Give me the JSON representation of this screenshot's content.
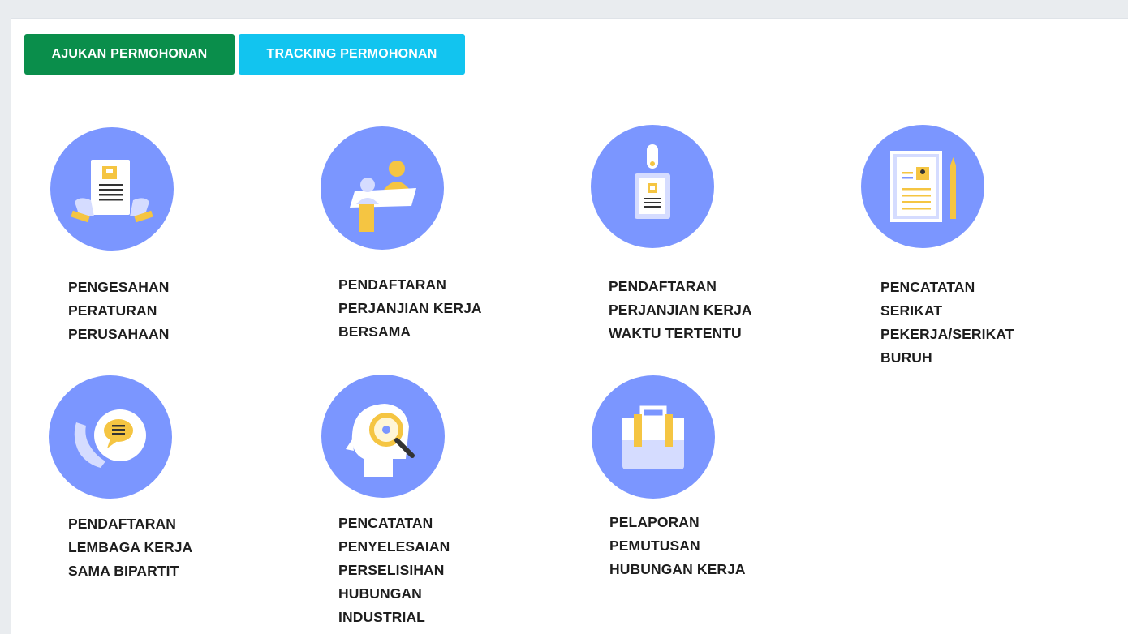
{
  "buttons": {
    "ajukan": "AJUKAN PERMOHONAN",
    "tracking": "TRACKING PERMOHONAN"
  },
  "colors": {
    "ajukan": "#0a8e4b",
    "tracking": "#12c4ef",
    "icon_circle": "#7b96ff",
    "icon_accent": "#f5c542"
  },
  "services": [
    {
      "icon": "document-hands-icon",
      "lines": [
        "PENGESAHAN",
        "PERATURAN",
        "PERUSAHAAN"
      ]
    },
    {
      "icon": "meeting-desk-icon",
      "lines": [
        "PENDAFTARAN",
        "PERJANJIAN KERJA",
        "BERSAMA"
      ]
    },
    {
      "icon": "id-badge-icon",
      "lines": [
        "PENDAFTARAN",
        "PERJANJIAN KERJA",
        "WAKTU TERTENTU"
      ]
    },
    {
      "icon": "document-pencil-icon",
      "lines": [
        "PENCATATAN",
        "SERIKAT",
        "PEKERJA/SERIKAT",
        "BURUH"
      ]
    },
    {
      "icon": "phone-chat-icon",
      "lines": [
        "PENDAFTARAN",
        "LEMBAGA KERJA",
        "SAMA BIPARTIT"
      ]
    },
    {
      "icon": "head-magnifier-icon",
      "lines": [
        "PENCATATAN",
        "PENYELESAIAN",
        "PERSELISIHAN",
        "HUBUNGAN",
        "INDUSTRIAL"
      ]
    },
    {
      "icon": "briefcase-icon",
      "lines": [
        "PELAPORAN",
        "PEMUTUSAN",
        "HUBUNGAN KERJA"
      ]
    }
  ]
}
